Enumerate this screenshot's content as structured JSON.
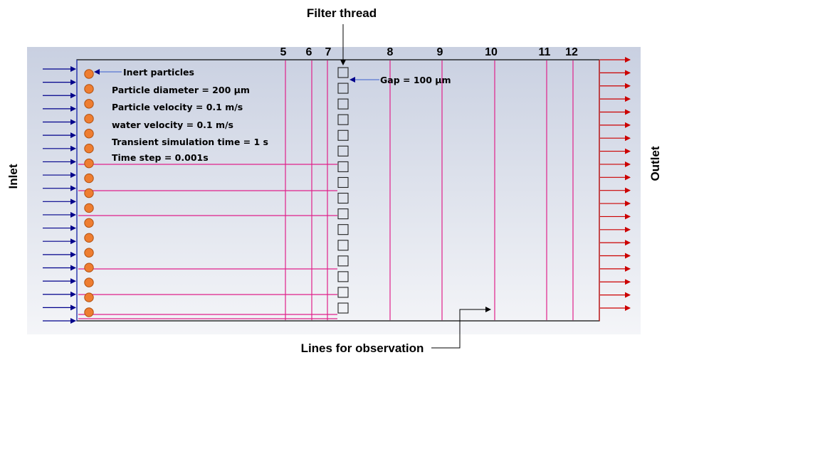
{
  "title_labels": {
    "filter_thread": "Filter thread",
    "inlet": "Inlet",
    "outlet": "Outlet",
    "lines_for_observation": "Lines for observation",
    "inert_particles": "Inert particles",
    "gap": "Gap = 100 μm"
  },
  "parameters": [
    "Particle diameter = 200 μm",
    "Particle velocity = 0.1 m/s",
    "water velocity = 0.1 m/s",
    "Transient simulation time = 1 s",
    "Time step = 0.001s"
  ],
  "vertical_line_labels": [
    "5",
    "6",
    "7",
    "8",
    "9",
    "10",
    "11",
    "12"
  ],
  "counts": {
    "particles": 17,
    "filter_squares": 16,
    "inlet_arrows": 20,
    "outlet_arrows": 20
  },
  "colors": {
    "inlet_arrow": "#00008b",
    "outlet_arrow": "#cc0000",
    "observation_line": "#e0218a",
    "particle_fill": "#ee7d31",
    "particle_stroke": "#b05010",
    "domain_border": "#000000",
    "background_top": "#c9d0e1",
    "background_bottom": "#f4f5f8"
  }
}
